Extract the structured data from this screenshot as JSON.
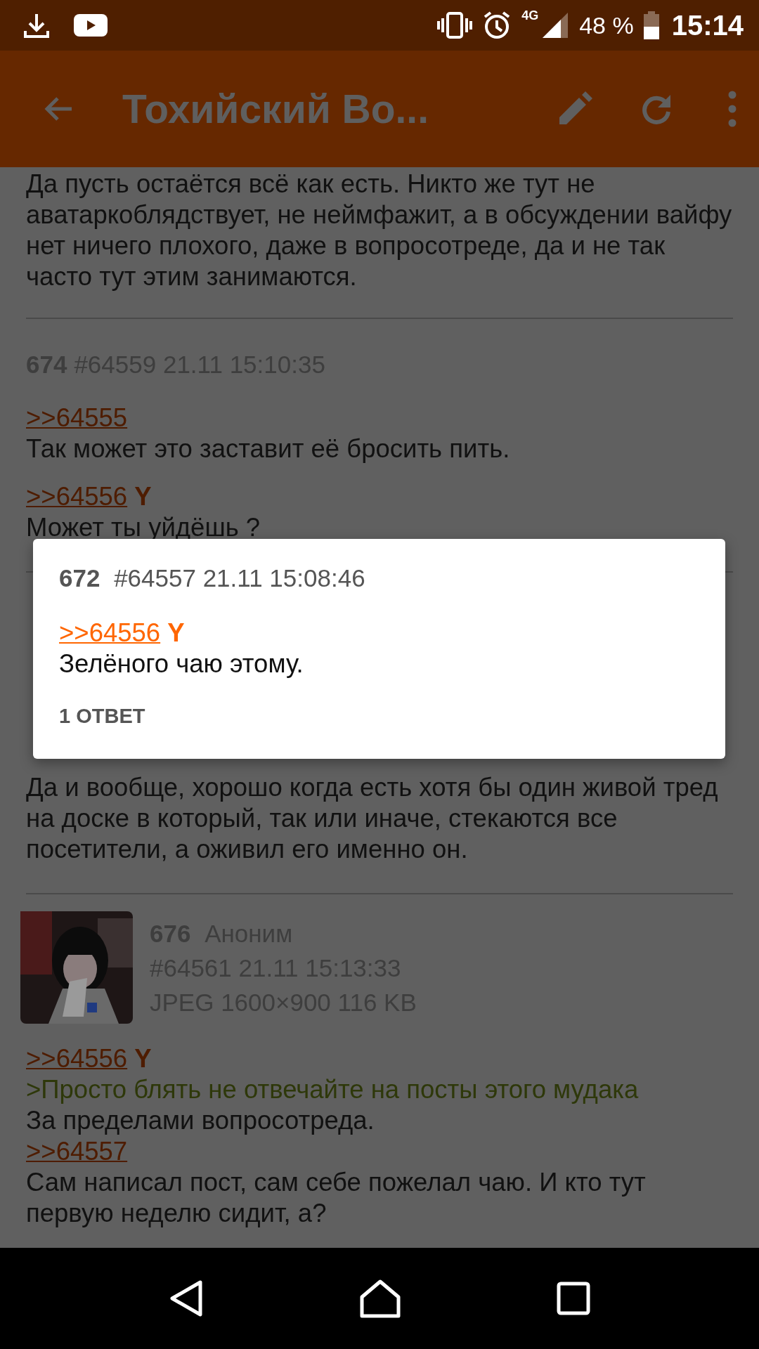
{
  "status_bar": {
    "network": "4G",
    "battery_text": "48 %",
    "time": "15:14"
  },
  "toolbar": {
    "title": "Тохийский Во..."
  },
  "posts": [
    {
      "kind": "cut",
      "blocks": [
        [
          {
            "kind": "text",
            "text": "Да пусть остаётся всё как есть. Никто же тут не аватаркоблядствует, не неймфажит, а в обсуждении вайфу нет ничего плохого, даже в вопросотреде, да и не так часто тут этим занимаются."
          }
        ]
      ]
    },
    {
      "kind": "post",
      "number": "674",
      "meta": "#64559 21.11 15:10:35",
      "blocks": [
        [
          {
            "kind": "reply",
            "text": ">>64555"
          },
          {
            "kind": "text",
            "text": "Так может это заставит её бросить пить."
          }
        ],
        [
          {
            "kind": "reply",
            "text": ">>64556",
            "you": "Y"
          },
          {
            "kind": "text",
            "text": "Может ты уйдёшь ?"
          }
        ]
      ]
    },
    {
      "kind": "covered",
      "blocks": [
        [
          {
            "kind": "text",
            "text": "Да и вообще, хорошо когда есть хотя бы один живой тред на доске в который, так или иначе, стекаются все посетители, а оживил его именно он."
          }
        ]
      ]
    },
    {
      "kind": "image_post",
      "number": "676",
      "name": "Аноним",
      "meta": "#64561 21.11 15:13:33",
      "file": "JPEG 1600×900 116 KB",
      "blocks": [
        [
          {
            "kind": "reply",
            "text": ">>64556",
            "you": "Y"
          },
          {
            "kind": "quote",
            "text": ">Просто блять не отвечайте на посты этого мудака"
          },
          {
            "kind": "text",
            "text": "За пределами вопросотреда."
          },
          {
            "kind": "reply",
            "text": ">>64557"
          },
          {
            "kind": "text",
            "text": "Сам написал пост, сам себе пожелал чаю. И кто тут первую неделю сидит, а?"
          }
        ]
      ]
    }
  ],
  "popup": {
    "number": "672",
    "meta": "#64557 21.11 15:08:46",
    "blocks": [
      [
        {
          "kind": "reply",
          "text": ">>64556",
          "you": "Y"
        },
        {
          "kind": "text",
          "text": "Зелёного чаю этому."
        }
      ]
    ],
    "replies": "1 ОТВЕТ"
  }
}
